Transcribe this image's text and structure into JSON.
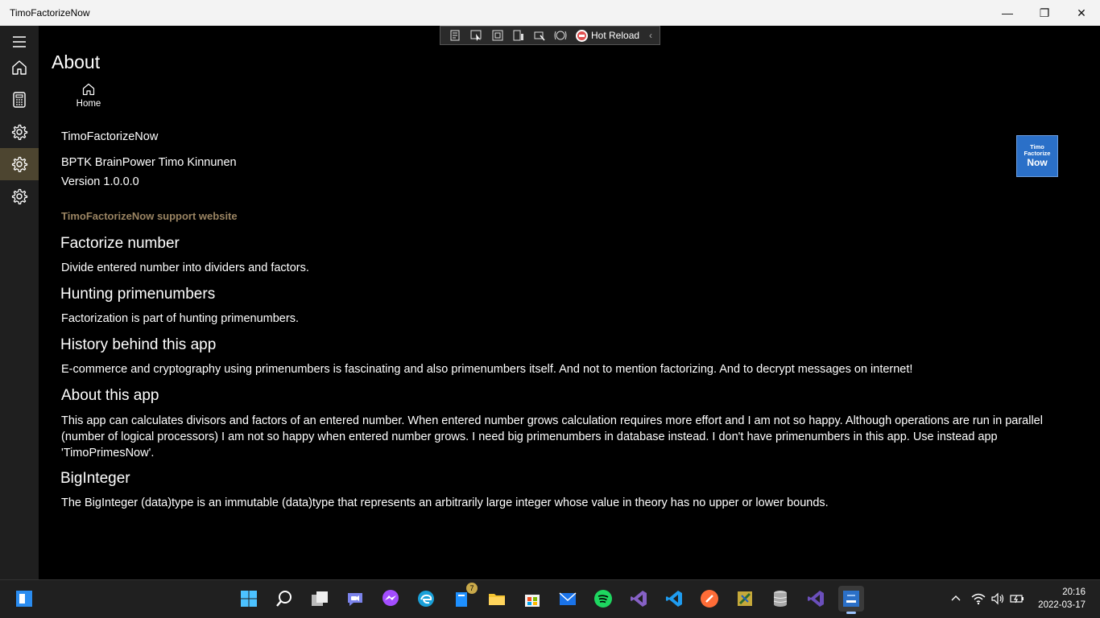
{
  "window": {
    "title": "TimoFactorizeNow",
    "minimize_glyph": "—",
    "maximize_glyph": "❐",
    "close_glyph": "✕"
  },
  "nav": {
    "items": [
      {
        "name": "hamburger-menu-icon"
      },
      {
        "name": "home-icon"
      },
      {
        "name": "calculator-icon"
      },
      {
        "name": "gear-icon"
      },
      {
        "name": "gear-icon",
        "selected": true
      },
      {
        "name": "gear-icon"
      }
    ],
    "selected_color": "#4d4530"
  },
  "hot_reload": {
    "label": "Hot Reload",
    "collapse_glyph": "‹"
  },
  "page": {
    "title": "About",
    "home_button_label": "Home",
    "app_name": "TimoFactorizeNow",
    "publisher": "BPTK BrainPower Timo Kinnunen",
    "version": "Version 1.0.0.0",
    "support_link": "TimoFactorizeNow support website",
    "link_color": "#9a8462",
    "logo": {
      "line1": "Timo",
      "line2": "Factorize",
      "line3": "Now",
      "color": "#2b70c8"
    },
    "sections": [
      {
        "heading": "Factorize number",
        "text": "Divide entered number into dividers and factors."
      },
      {
        "heading": "Hunting primenumbers",
        "text": "Factorization is part of hunting primenumbers."
      },
      {
        "heading": "History behind this app",
        "text": "E-commerce and cryptography using primenumbers is fascinating and also primenumbers itself. And not to mention factorizing. And to decrypt messages on internet!"
      },
      {
        "heading": "About this app",
        "text": "This app can calculates divisors and factors of an entered number. When entered number grows calculation requires more effort and I am not so happy. Although operations are run in parallel (number of logical processors) I am not so happy when entered number grows. I need big primenumbers in database instead. I don't have primenumbers in this app. Use instead app 'TimoPrimesNow'."
      },
      {
        "heading": "BigInteger",
        "text": "The BigInteger (data)type is an immutable (data)type that represents an arbitrarily large integer whose value in theory has no upper or lower bounds."
      }
    ]
  },
  "taskbar": {
    "icons": [
      "windows-start-icon",
      "start-menu-icon",
      "search-icon",
      "task-view-icon",
      "teams-chat-icon",
      "messenger-icon",
      "edge-icon",
      "notes-icon",
      "file-explorer-icon",
      "store-icon",
      "mail-icon",
      "spotify-icon",
      "visual-studio-icon",
      "vscode-icon",
      "postman-icon",
      "paint-icon",
      "database-icon",
      "visual-studio-preview-icon",
      "timo-factorize-now-icon"
    ],
    "notes_badge": "7",
    "clock_time": "20:16",
    "clock_date": "2022-03-17"
  }
}
